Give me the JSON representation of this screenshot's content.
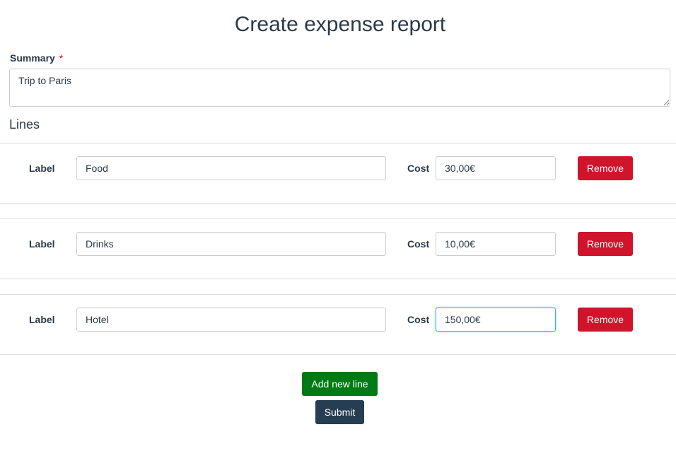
{
  "page": {
    "title": "Create expense report"
  },
  "summary": {
    "label": "Summary",
    "required_mark": "*",
    "value": "Trip to Paris"
  },
  "lines": {
    "heading": "Lines",
    "field_label": "Label",
    "cost_label": "Cost",
    "remove_label": "Remove",
    "items": [
      {
        "label": "Food",
        "cost": "30,00€"
      },
      {
        "label": "Drinks",
        "cost": "10,00€"
      },
      {
        "label": "Hotel",
        "cost": "150,00€"
      }
    ]
  },
  "actions": {
    "add_line_label": "Add new line",
    "submit_label": "Submit"
  },
  "colors": {
    "remove": "#d0142b",
    "add": "#007a14",
    "submit": "#263d52",
    "required": "#d0021b"
  }
}
